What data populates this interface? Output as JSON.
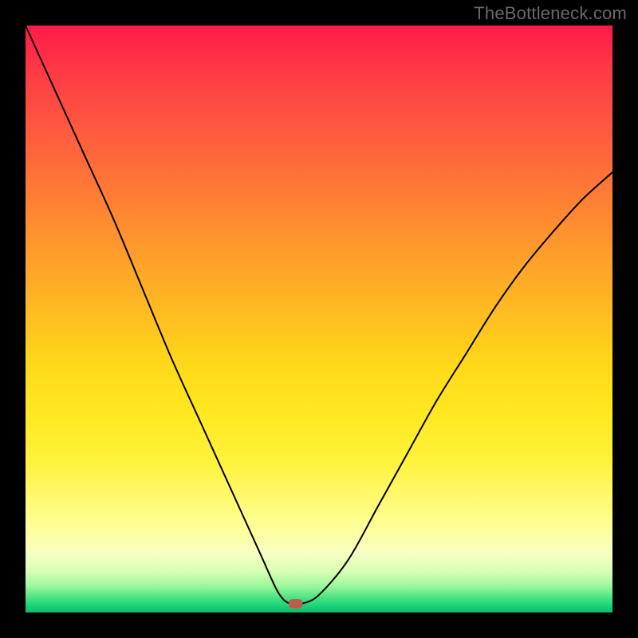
{
  "watermark": {
    "text": "TheBottleneck.com"
  },
  "chart_data": {
    "type": "line",
    "title": "",
    "xlabel": "",
    "ylabel": "",
    "xlim": [
      0,
      100
    ],
    "ylim": [
      0,
      100
    ],
    "grid": false,
    "legend": false,
    "background_gradient": {
      "direction": "vertical",
      "stops": [
        {
          "pos": 0.0,
          "color": "#ff1a4a"
        },
        {
          "pos": 0.5,
          "color": "#ffbf20"
        },
        {
          "pos": 0.8,
          "color": "#fff96a"
        },
        {
          "pos": 0.95,
          "color": "#9cf79c"
        },
        {
          "pos": 1.0,
          "color": "#0fba6c"
        }
      ]
    },
    "series": [
      {
        "name": "bottleneck-curve",
        "color": "#000000",
        "stroke_width": 2,
        "x": [
          0,
          5,
          10,
          15,
          20,
          25,
          30,
          35,
          40,
          43,
          45,
          47,
          50,
          55,
          60,
          65,
          70,
          75,
          80,
          85,
          90,
          95,
          100
        ],
        "y": [
          100,
          89,
          78,
          67,
          55,
          43,
          32,
          21,
          10,
          3.5,
          1.5,
          1.5,
          3,
          9,
          18,
          27,
          36,
          44,
          52,
          59,
          65,
          70.5,
          75
        ]
      }
    ],
    "markers": [
      {
        "name": "optimal-point",
        "x": 46,
        "y": 1.5,
        "shape": "rounded-rect",
        "width_pct": 2.4,
        "height_pct": 1.6,
        "fill": "#c05b4f"
      }
    ]
  }
}
